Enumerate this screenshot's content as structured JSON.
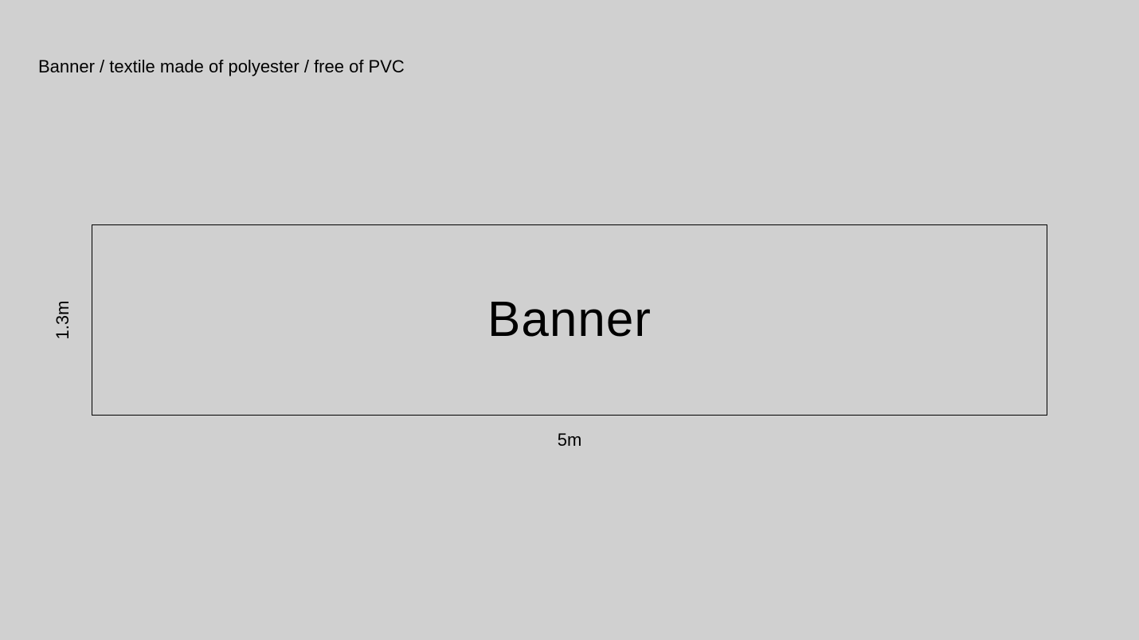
{
  "caption": "Banner / textile made of polyester / free of PVC",
  "banner": {
    "label": "Banner",
    "width_label": "5m",
    "height_label": "1.3m"
  }
}
